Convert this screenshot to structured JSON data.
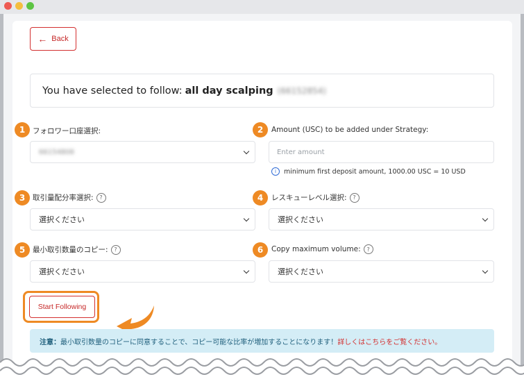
{
  "back_label": "Back",
  "selected": {
    "prefix": "You have selected to follow:",
    "strategy_name": "all day scalping",
    "account_id": "(66152854)"
  },
  "fields": {
    "f1": {
      "number": "1",
      "label": "フォロワー口座選択:",
      "value": "66154808"
    },
    "f2": {
      "number": "2",
      "label": "Amount (USC) to be added under Strategy:",
      "placeholder": "Enter amount"
    },
    "f2_info": "minimum first deposit amount, 1000.00 USC = 10 USD",
    "f3": {
      "number": "3",
      "label": "取引量配分率選択:",
      "value": "選択ください"
    },
    "f4": {
      "number": "4",
      "label": "レスキューレベル選択:",
      "value": "選択ください"
    },
    "f5": {
      "number": "5",
      "label": "最小取引数量のコピー:",
      "value": "選択ください"
    },
    "f6": {
      "number": "6",
      "label": "Copy maximum volume:",
      "value": "選択ください"
    }
  },
  "start_button_label": "Start Following",
  "notice": {
    "strong": "注意：",
    "text": "最小取引数量のコピーに同意することで、コピー可能な比率が増加することになります！",
    "link": "詳しくはこちらをご覧ください。"
  },
  "colors": {
    "accent_orange": "#ee8a24",
    "button_red": "#c62828",
    "notice_bg": "#d4edf6"
  }
}
